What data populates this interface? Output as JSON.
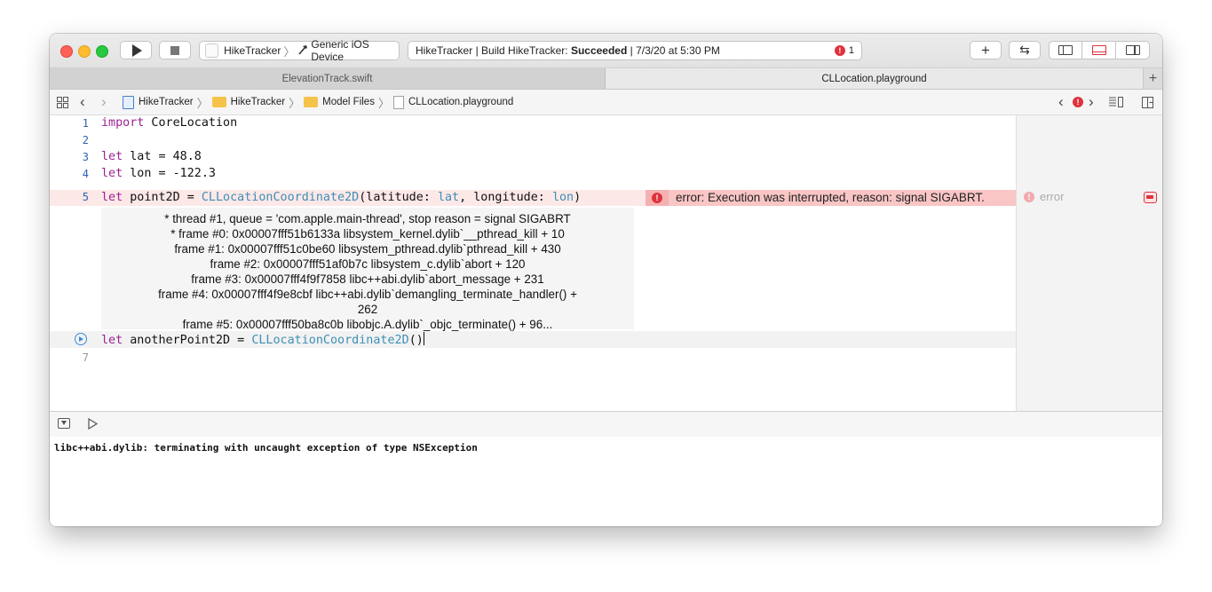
{
  "toolbar": {
    "scheme_target": "HikeTracker",
    "scheme_device": "Generic iOS Device",
    "status_prefix": "HikeTracker | Build HikeTracker: ",
    "status_result": "Succeeded",
    "status_time": " | 7/3/20 at 5:30 PM",
    "error_count": "1",
    "add_label": "+",
    "review_label": "⇆"
  },
  "tabs": [
    {
      "label": "ElevationTrack.swift",
      "active": false
    },
    {
      "label": "CLLocation.playground",
      "active": true
    }
  ],
  "tab_add": "+",
  "breadcrumb": [
    "HikeTracker",
    "HikeTracker",
    "Model Files",
    "CLLocation.playground"
  ],
  "code": {
    "line_numbers": [
      "1",
      "2",
      "3",
      "4",
      "5",
      "7"
    ],
    "line1_kw": "import",
    "line1_rest": " CoreLocation",
    "line3_kw": "let",
    "line3_rest": " lat = 48.8",
    "line4_kw": "let",
    "line4_rest": " lon = -122.3",
    "line5_kw": "let",
    "line5_name": " point2D = ",
    "line5_type": "CLLocationCoordinate2D",
    "line5_open": "(latitude: ",
    "line5_arg1": "lat",
    "line5_mid": ", longitude: ",
    "line5_arg2": "lon",
    "line5_close": ")",
    "line6_kw": "let",
    "line6_name": " anotherPoint2D = ",
    "line6_type": "CLLocationCoordinate2D",
    "line6_close": "()"
  },
  "error": {
    "message": "error: Execution was interrupted, reason: signal SIGABRT.",
    "result_label": "error"
  },
  "stack_trace": [
    "* thread #1, queue = 'com.apple.main-thread', stop reason = signal SIGABRT",
    "* frame #0: 0x00007fff51b6133a libsystem_kernel.dylib`__pthread_kill + 10",
    "frame #1: 0x00007fff51c0be60 libsystem_pthread.dylib`pthread_kill + 430",
    "frame #2: 0x00007fff51af0b7c libsystem_c.dylib`abort + 120",
    "frame #3: 0x00007fff4f9f7858 libc++abi.dylib`abort_message + 231",
    "frame #4: 0x00007fff4f9e8cbf libc++abi.dylib`demangling_terminate_handler() +",
    "262",
    "frame #5: 0x00007fff50ba8c0b libobjc.A.dylib`_objc_terminate() + 96..."
  ],
  "console": {
    "output": "libc++abi.dylib: terminating with uncaught exception of type NSException"
  },
  "colors": {
    "keyword": "#9b2393",
    "type": "#3d8fb5",
    "error_red": "#e0323c",
    "error_line_bg": "#fde8e8",
    "error_banner_bg": "#f9c5c5"
  }
}
